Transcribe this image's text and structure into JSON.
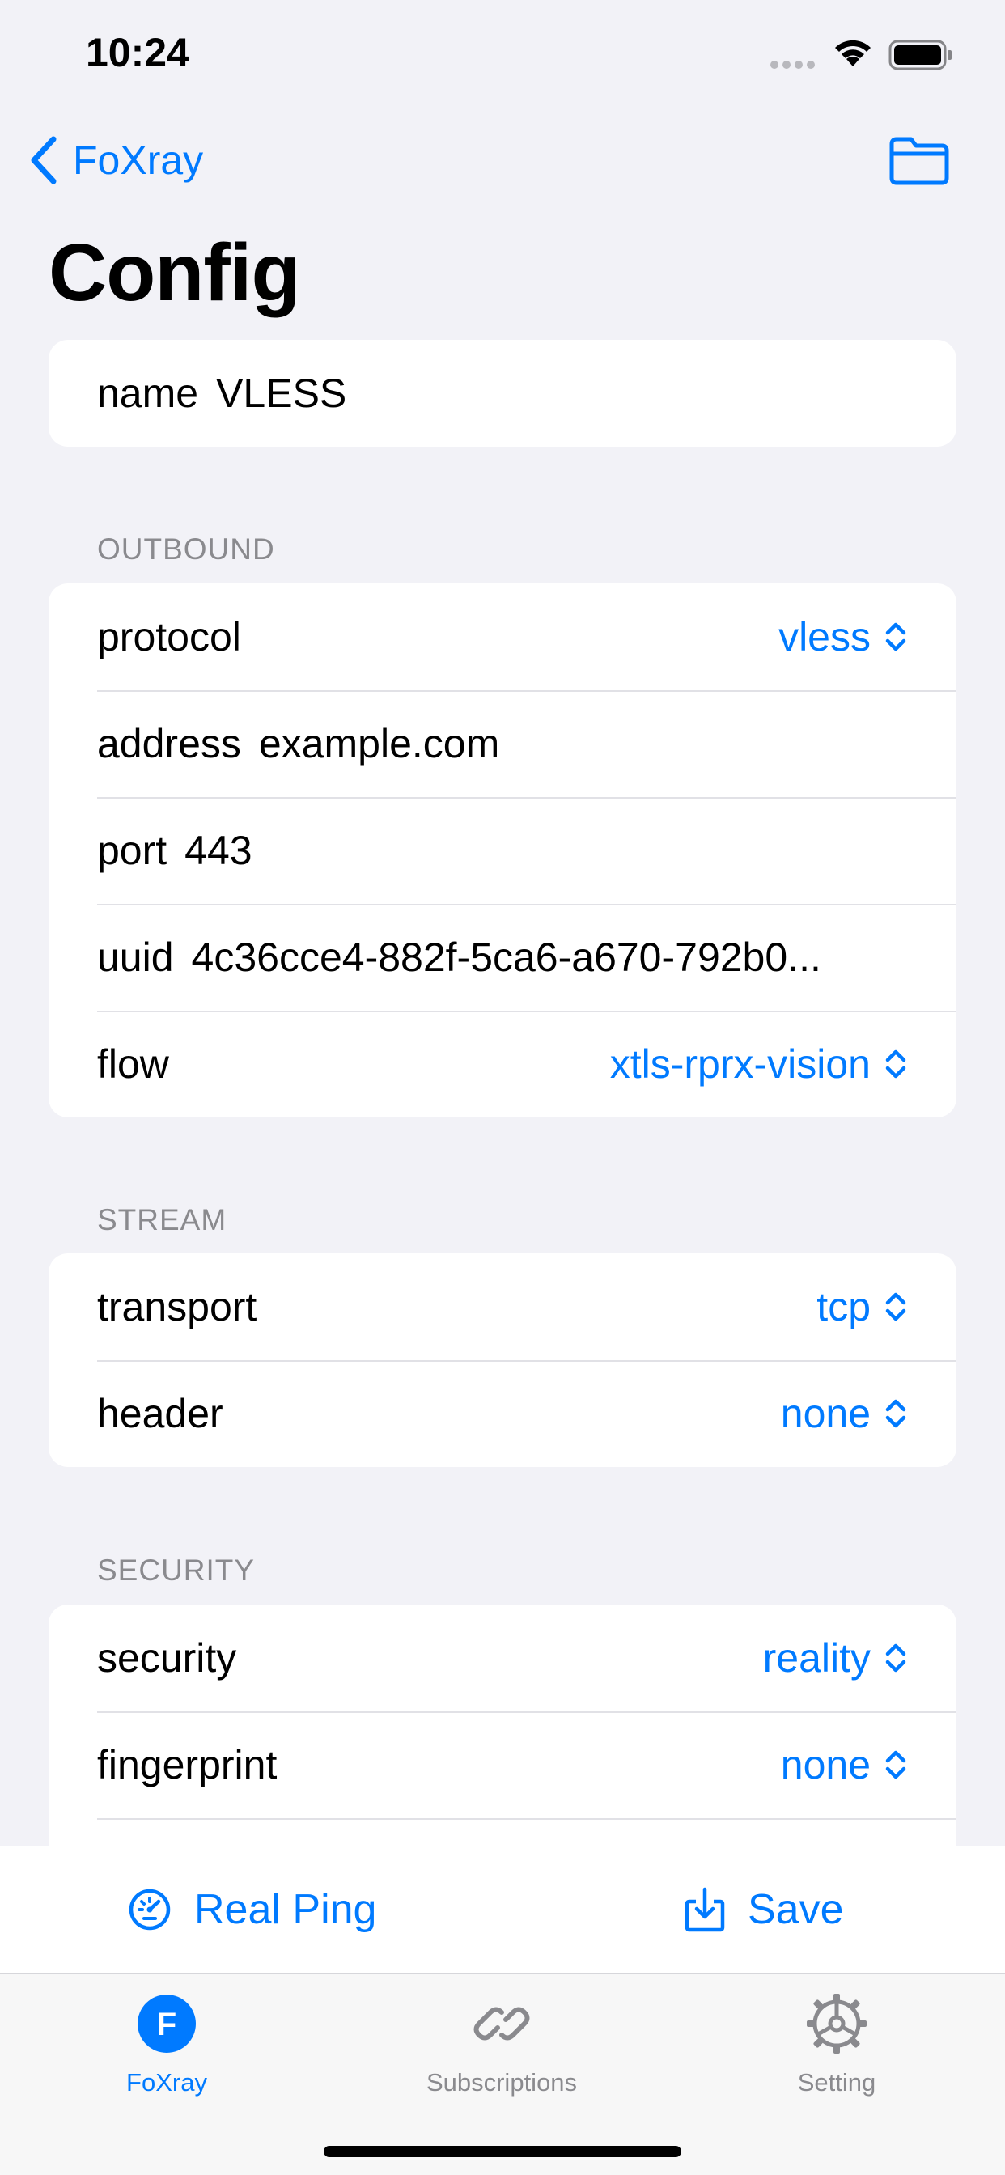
{
  "status_bar": {
    "time": "10:24"
  },
  "nav": {
    "back_label": "FoXray",
    "title": "Config"
  },
  "name_row": {
    "key": "name",
    "value": "VLESS"
  },
  "outbound": {
    "header": "OUTBOUND",
    "protocol": {
      "key": "protocol",
      "value": "vless"
    },
    "address": {
      "key": "address",
      "value": "example.com"
    },
    "port": {
      "key": "port",
      "value": "443"
    },
    "uuid": {
      "key": "uuid",
      "value": "4c36cce4-882f-5ca6-a670-792b0..."
    },
    "flow": {
      "key": "flow",
      "value": "xtls-rprx-vision"
    }
  },
  "stream": {
    "header": "STREAM",
    "transport": {
      "key": "transport",
      "value": "tcp"
    },
    "header_row": {
      "key": "header",
      "value": "none"
    }
  },
  "security": {
    "header": "SECURITY",
    "security": {
      "key": "security",
      "value": "reality"
    },
    "fingerprint": {
      "key": "fingerprint",
      "value": "none"
    }
  },
  "actions": {
    "real_ping": "Real Ping",
    "save": "Save"
  },
  "tabs": [
    {
      "label": "FoXray",
      "icon": "foxray-app-icon",
      "letter": "F",
      "active": true
    },
    {
      "label": "Subscriptions",
      "icon": "link-icon",
      "active": false
    },
    {
      "label": "Setting",
      "icon": "gear-icon",
      "active": false
    }
  ],
  "colors": {
    "accent": "#007aff",
    "background": "#f2f2f7",
    "secondary_text": "#8a8a8e"
  }
}
